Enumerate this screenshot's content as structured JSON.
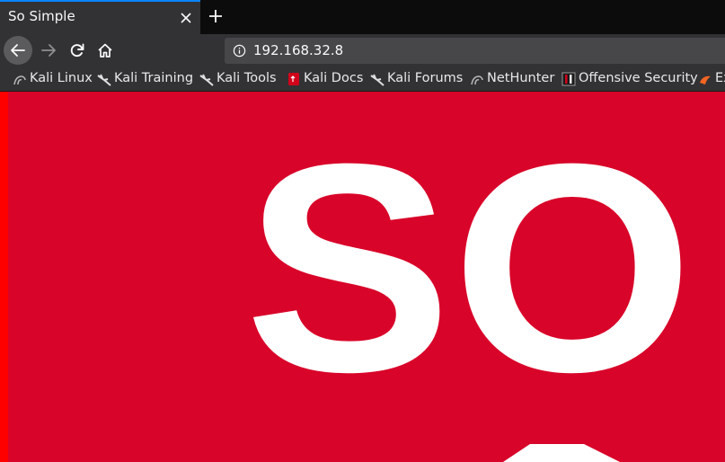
{
  "browser": {
    "tab": {
      "title": "So Simple"
    },
    "url": "192.168.32.8",
    "bookmarks": [
      {
        "label": "Kali Linux",
        "icon": "kali-dragon-icon"
      },
      {
        "label": "Kali Training",
        "icon": "kali-dragon-icon"
      },
      {
        "label": "Kali Tools",
        "icon": "kali-dragon-icon"
      },
      {
        "label": "Kali Docs",
        "icon": "kali-docs-icon"
      },
      {
        "label": "Kali Forums",
        "icon": "kali-dragon-icon"
      },
      {
        "label": "NetHunter",
        "icon": "kali-dragon-icon"
      },
      {
        "label": "Offensive Security",
        "icon": "offsec-icon"
      },
      {
        "label": "Ex",
        "icon": "exploit-db-icon"
      }
    ]
  },
  "page": {
    "logo_text": "SO",
    "background_color": "#d90429"
  }
}
